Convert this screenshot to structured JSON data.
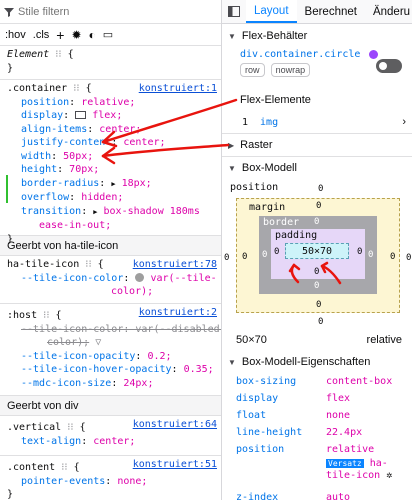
{
  "rules_pane": {
    "filter_placeholder": "Stile filtern",
    "toolbar": {
      "hov": ":hov",
      "cls": ".cls",
      "add": "+"
    },
    "element_rule": {
      "selector": "Element",
      "brace_open": "{",
      "brace_close": "}"
    },
    "container_rule": {
      "selector": ".container",
      "brace_open": "{",
      "brace_close": "}",
      "source": "konstruiert:1",
      "props": [
        {
          "name": "position",
          "value": "relative;"
        },
        {
          "name": "display",
          "value": "flex;"
        },
        {
          "name": "align-items",
          "value": "center;"
        },
        {
          "name": "justify-content",
          "value": "center;"
        },
        {
          "name": "width",
          "value": "50px;"
        },
        {
          "name": "height",
          "value": "70px;"
        },
        {
          "name": "border-radius",
          "value": "18px;"
        },
        {
          "name": "overflow",
          "value": "hidden;"
        },
        {
          "name": "transition",
          "value": "box-shadow 180ms"
        },
        {
          "name": "",
          "value": "ease-in-out;"
        }
      ]
    },
    "inherited_1": "Geerbt von ha-tile-icon",
    "tile_icon_rule": {
      "selector": "ha-tile-icon",
      "source": "konstruiert:78",
      "prop_name": "--tile-icon-color",
      "prop_value": "var(--tile-",
      "prop_value_2": "color);"
    },
    "host_rule": {
      "selector": ":host",
      "source": "konstruiert:2",
      "struck_1": "--tile-icon-color: var(--disabled-",
      "struck_2": "color);",
      "props": [
        {
          "name": "--tile-icon-opacity",
          "value": "0.2;"
        },
        {
          "name": "--tile-icon-hover-opacity",
          "value": "0.35;"
        },
        {
          "name": "--mdc-icon-size",
          "value": "24px;"
        }
      ]
    },
    "inherited_2": "Geerbt von div",
    "vertical_rule": {
      "selector": ".vertical",
      "source": "konstruiert:64",
      "prop_name": "text-align",
      "prop_value": "center;"
    },
    "content_rule": {
      "selector": ".content",
      "source": "konstruiert:51",
      "prop_name": "pointer-events",
      "prop_value": "none;"
    }
  },
  "layout_pane": {
    "tabs": [
      "Layout",
      "Berechnet",
      "Änderu"
    ],
    "flex_container_title": "Flex-Behälter",
    "flex_element": "div.container.circle",
    "badges": [
      "row",
      "nowrap"
    ],
    "flex_items_title": "Flex-Elemente",
    "flex_item_index": "1",
    "flex_item_name": "img",
    "grid_title": "Raster",
    "box_model_title": "Box-Modell",
    "box_model": {
      "position_label": "position",
      "margin_label": "margin",
      "border_label": "border",
      "padding_label": "padding",
      "content_size": "50×70",
      "zero": "0",
      "footer_size": "50×70",
      "footer_position": "relative"
    },
    "box_props_title": "Box-Modell-Eigenschaften",
    "box_props": [
      {
        "name": "box-sizing",
        "value": "content-box"
      },
      {
        "name": "display",
        "value": "flex"
      },
      {
        "name": "float",
        "value": "none"
      },
      {
        "name": "line-height",
        "value": "22.4px"
      },
      {
        "name": "position",
        "value": "relative"
      }
    ],
    "offset_badge": "Versatz",
    "offset_value_1": "ha-",
    "offset_value_2": "tile-icon",
    "zindex_name": "z-index",
    "zindex_value": "auto"
  },
  "colors": {
    "annotation_red": "#e8140e",
    "accent_blue": "#0a84ff",
    "property_blue": "#0074e8",
    "value_magenta": "#dd00a9",
    "margin_fill": "#fdf6d3",
    "border_fill": "#a7a7ab",
    "padding_fill": "#e6d7f8",
    "content_fill": "#cdf3f9",
    "flex_purple": "#9b46fc"
  }
}
